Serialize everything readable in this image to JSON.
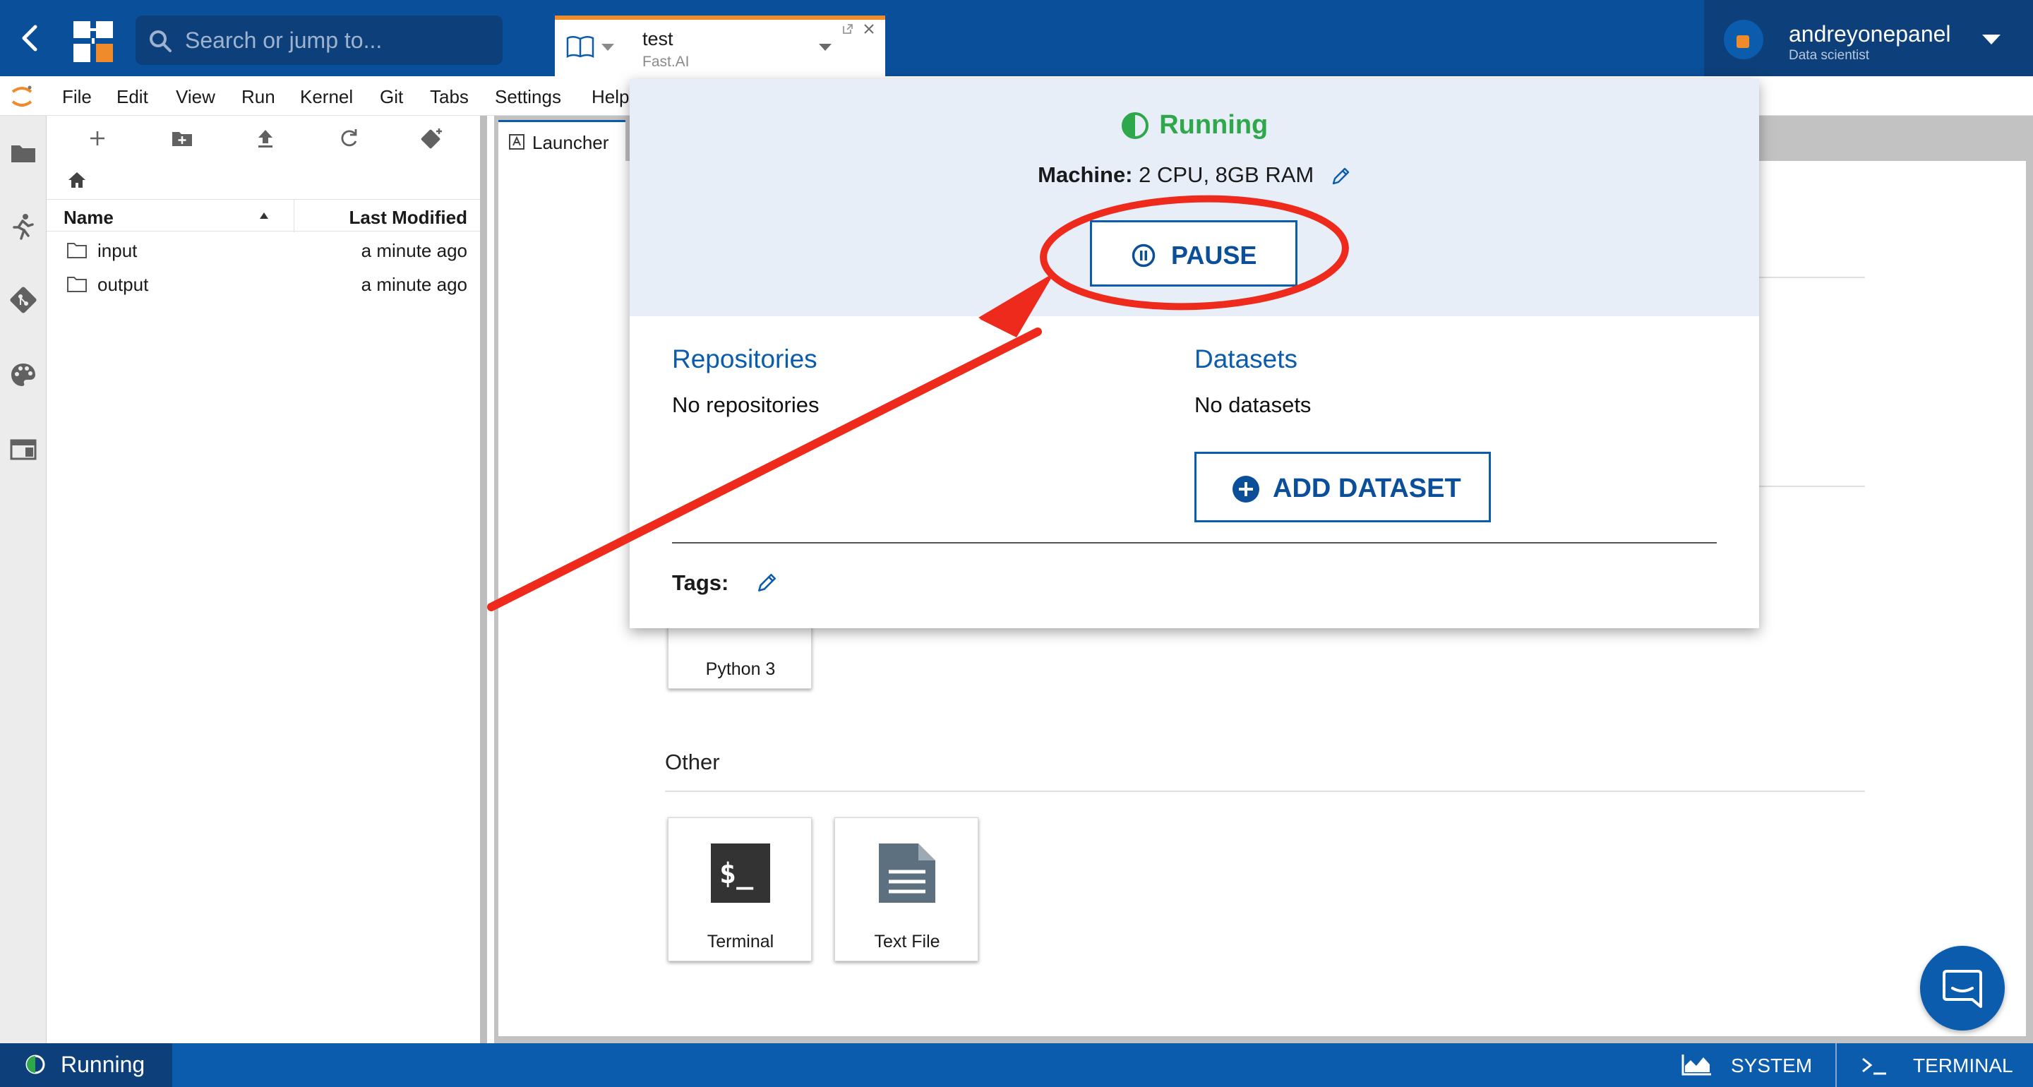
{
  "topbar": {
    "search_placeholder": "Search or jump to...",
    "notebook_tab": {
      "title": "test",
      "subtitle": "Fast.AI"
    },
    "user": {
      "name": "andreyonepanel",
      "role": "Data scientist"
    },
    "colors": {
      "primary": "#0a4f9a",
      "accent": "#f08b2b"
    }
  },
  "menu": [
    "File",
    "Edit",
    "View",
    "Run",
    "Kernel",
    "Git",
    "Tabs",
    "Settings",
    "Help"
  ],
  "sidebar_icons": [
    "folder-icon",
    "running-icon",
    "git-icon",
    "palette-icon",
    "tabs-icon"
  ],
  "filebrowser": {
    "toolbar_icons": [
      "new-launcher-icon",
      "new-folder-icon",
      "upload-icon",
      "refresh-icon",
      "git-clone-icon"
    ],
    "columns": {
      "name": "Name",
      "modified": "Last Modified"
    },
    "rows": [
      {
        "name": "input",
        "modified": "a minute ago"
      },
      {
        "name": "output",
        "modified": "a minute ago"
      }
    ]
  },
  "main": {
    "tab_label": "Launcher",
    "sections": {
      "other_title": "Other"
    },
    "cards": {
      "python": "Python 3",
      "terminal": "Terminal",
      "text_file": "Text File"
    }
  },
  "popup": {
    "status": "Running",
    "status_color": "#2ea84a",
    "machine_label": "Machine:",
    "machine_value": "2 CPU, 8GB RAM",
    "pause_label": "PAUSE",
    "repositories_title": "Repositories",
    "repositories_empty": "No repositories",
    "datasets_title": "Datasets",
    "datasets_empty": "No datasets",
    "add_dataset_label": "ADD DATASET",
    "tags_label": "Tags:"
  },
  "annotation": {
    "color": "#ee2a1c",
    "description_kind": "arrow-and-circle-highlight"
  },
  "statusbar": {
    "running_label": "Running",
    "system_label": "SYSTEM",
    "terminal_label": "TERMINAL"
  }
}
